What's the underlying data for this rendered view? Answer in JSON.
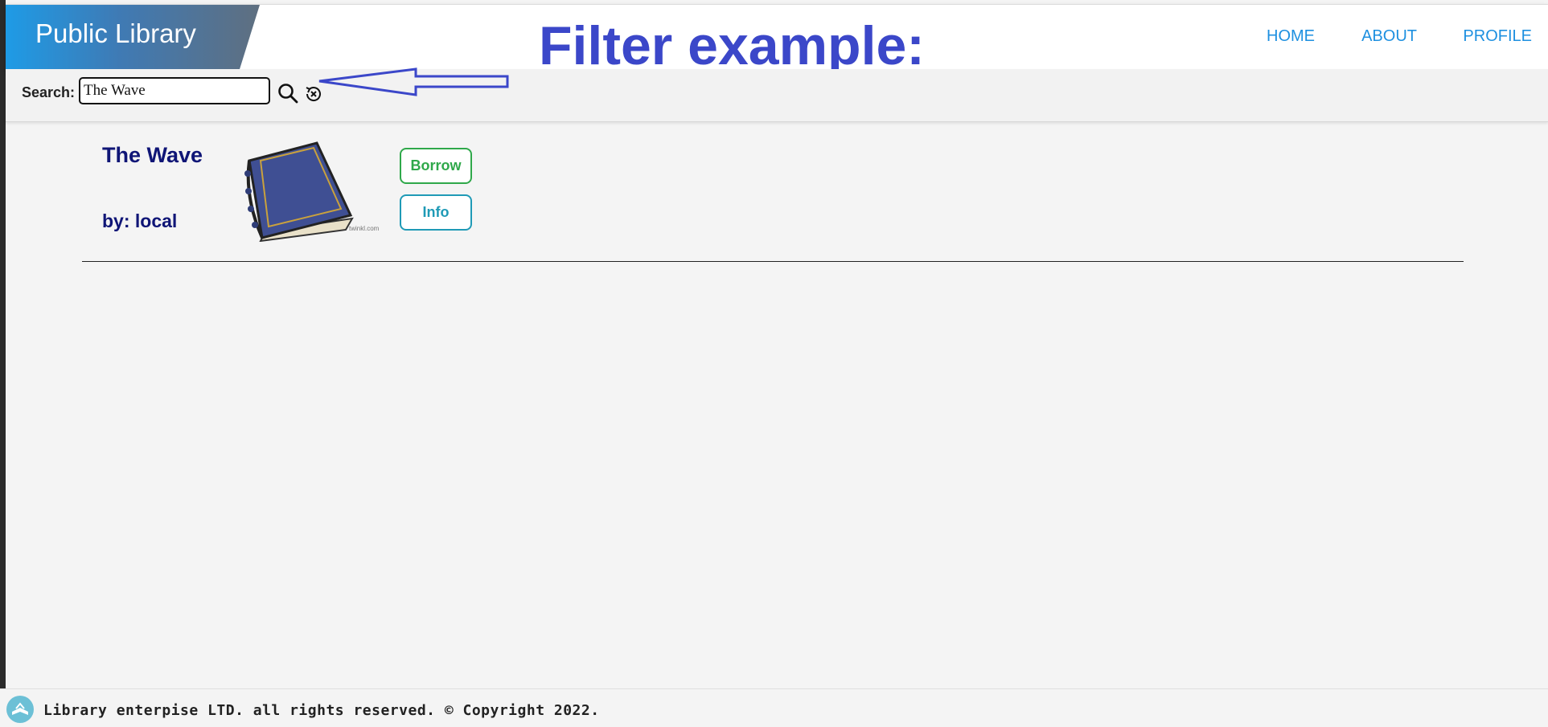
{
  "header": {
    "brand": "Public Library",
    "nav": [
      {
        "label": "HOME"
      },
      {
        "label": "ABOUT"
      },
      {
        "label": "PROFILE"
      }
    ]
  },
  "annotation": {
    "title": "Filter example:"
  },
  "search": {
    "label": "Search:",
    "value": "The Wave"
  },
  "results": [
    {
      "title": "The Wave",
      "author": "by: local",
      "image_credit": "twinkl.com",
      "borrow_label": "Borrow",
      "info_label": "Info"
    }
  ],
  "footer": {
    "text": "Library enterpise LTD. all rights reserved. © Copyright 2022."
  },
  "colors": {
    "brand_gradient_start": "#1e9be6",
    "nav_link": "#1e90e0",
    "annotation": "#3b47c9",
    "book_text": "#0f1576",
    "borrow": "#2fa84a",
    "info": "#1f9ab6"
  }
}
